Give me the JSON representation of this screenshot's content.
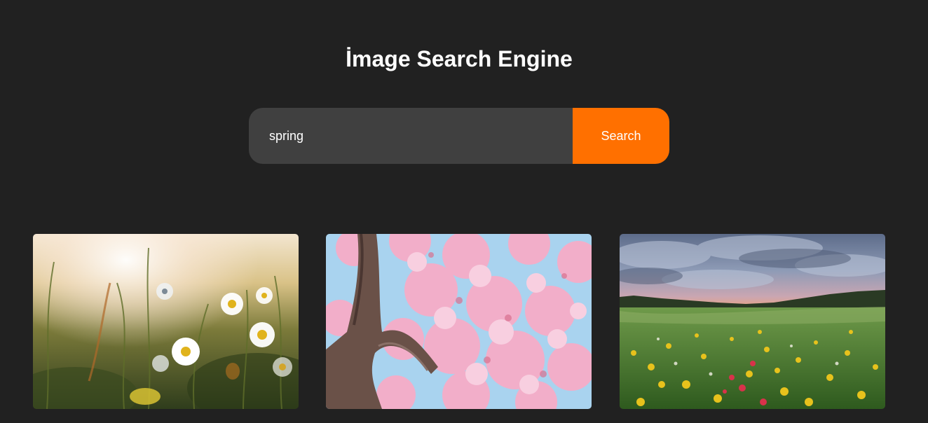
{
  "header": {
    "title": "İmage Search Engine"
  },
  "search": {
    "value": "spring",
    "placeholder": "",
    "button_label": "Search"
  },
  "results": [
    {
      "subject": "daisies-in-meadow-photo"
    },
    {
      "subject": "cherry-blossom-tree-photo"
    },
    {
      "subject": "wildflower-field-landscape-photo"
    }
  ],
  "colors": {
    "background": "#212121",
    "input_background": "#404040",
    "accent": "#ff7000",
    "text": "#ffffff"
  }
}
